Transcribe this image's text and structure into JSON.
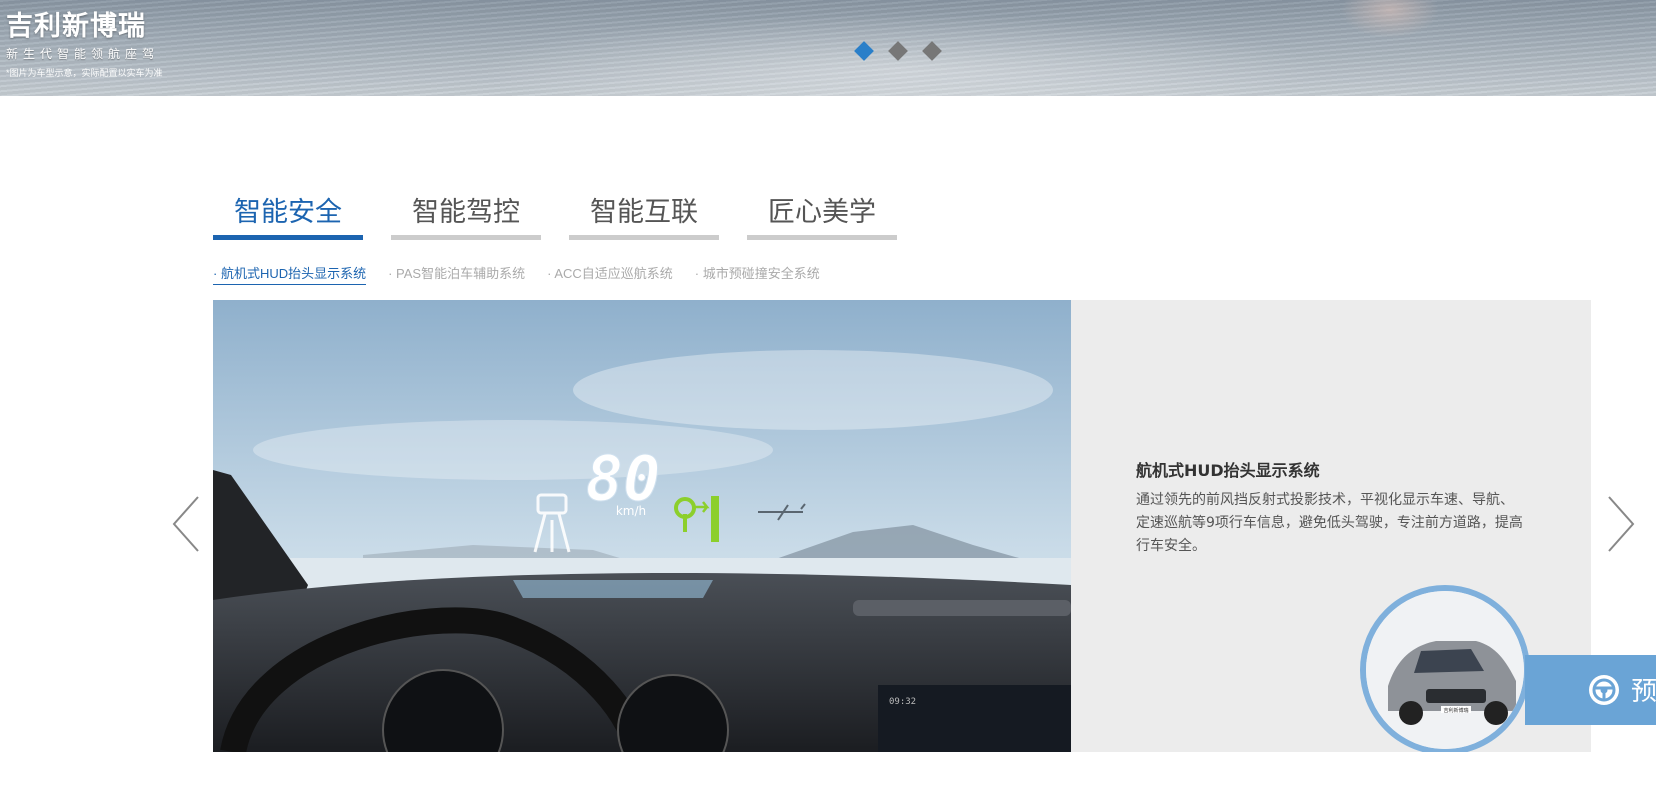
{
  "banner": {
    "brand": "吉利新博瑞",
    "slogan": "新生代智能领航座驾",
    "note": "*图片为车型示意，实际配置以实车为准",
    "slide_count": 3,
    "active_slide": 1
  },
  "tabs": [
    {
      "label": "智能安全",
      "active": true
    },
    {
      "label": "智能驾控",
      "active": false
    },
    {
      "label": "智能互联",
      "active": false
    },
    {
      "label": "匠心美学",
      "active": false
    }
  ],
  "subtabs": [
    {
      "label": "· 航机式HUD抬头显示系统",
      "active": true
    },
    {
      "label": "· PAS智能泊车辅助系统",
      "active": false
    },
    {
      "label": "· ACC自适应巡航系统",
      "active": false
    },
    {
      "label": "· 城市预碰撞安全系统",
      "active": false
    }
  ],
  "feature": {
    "title": "航机式HUD抬头显示系统",
    "description": "通过领先的前风挡反射式投影技术，平视化显示车速、导航、定速巡航等9项行车信息，避免低头驾驶，专注前方道路，提高行车安全。",
    "hud_speed": "80",
    "hud_unit": "km/h",
    "clock": "09:32",
    "car_plate": "吉利新博瑞"
  },
  "preorder": {
    "label": "预"
  },
  "colors": {
    "accent": "#1c64b0",
    "dot_active": "#2a7fc9",
    "preorder_bg": "#6aa4d6",
    "panel_bg": "#ececec"
  },
  "icons": {
    "arrow_left": "chevron-left-icon",
    "arrow_right": "chevron-right-icon",
    "preorder": "steering-wheel-icon"
  }
}
